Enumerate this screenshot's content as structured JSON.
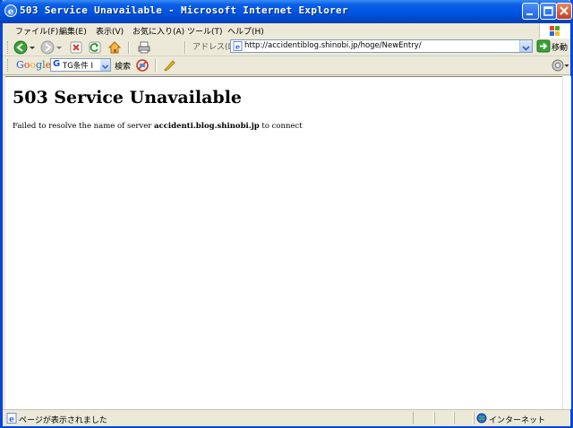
{
  "window": {
    "title": "503 Service Unavailable - Microsoft Internet Explorer"
  },
  "menu": {
    "items": [
      "ファイル(F)",
      "編集(E)",
      "表示(V)",
      "お気に入り(A)",
      "ツール(T)",
      "ヘルプ(H)"
    ]
  },
  "address_bar": {
    "label": "アドレス(D)",
    "url": "http://accidentiblog.shinobi.jp/hoge/NewEntry/",
    "go_label": "移動"
  },
  "google_bar": {
    "logo": "Google",
    "search_value": "TG条件 I",
    "search_label": "検索"
  },
  "page": {
    "heading": "503 Service Unavailable",
    "message_prefix": "Failed to resolve the name of server ",
    "server": "accidenti.blog.shinobi.jp",
    "message_suffix": " to connect"
  },
  "status_bar": {
    "text": "ページが表示されました",
    "zone": "インターネット"
  },
  "colors": {
    "titlebar": "#0054e3",
    "close_button": "#c6411b",
    "chrome": "#ece9d8"
  },
  "icons": {
    "title": "ie-logo-icon",
    "back": "back-arrow-icon",
    "forward": "forward-arrow-icon",
    "stop": "stop-icon",
    "refresh": "refresh-icon",
    "home": "home-icon",
    "print": "print-icon",
    "go": "go-arrow-icon",
    "status": "ie-page-icon",
    "zone": "internet-globe-icon"
  }
}
